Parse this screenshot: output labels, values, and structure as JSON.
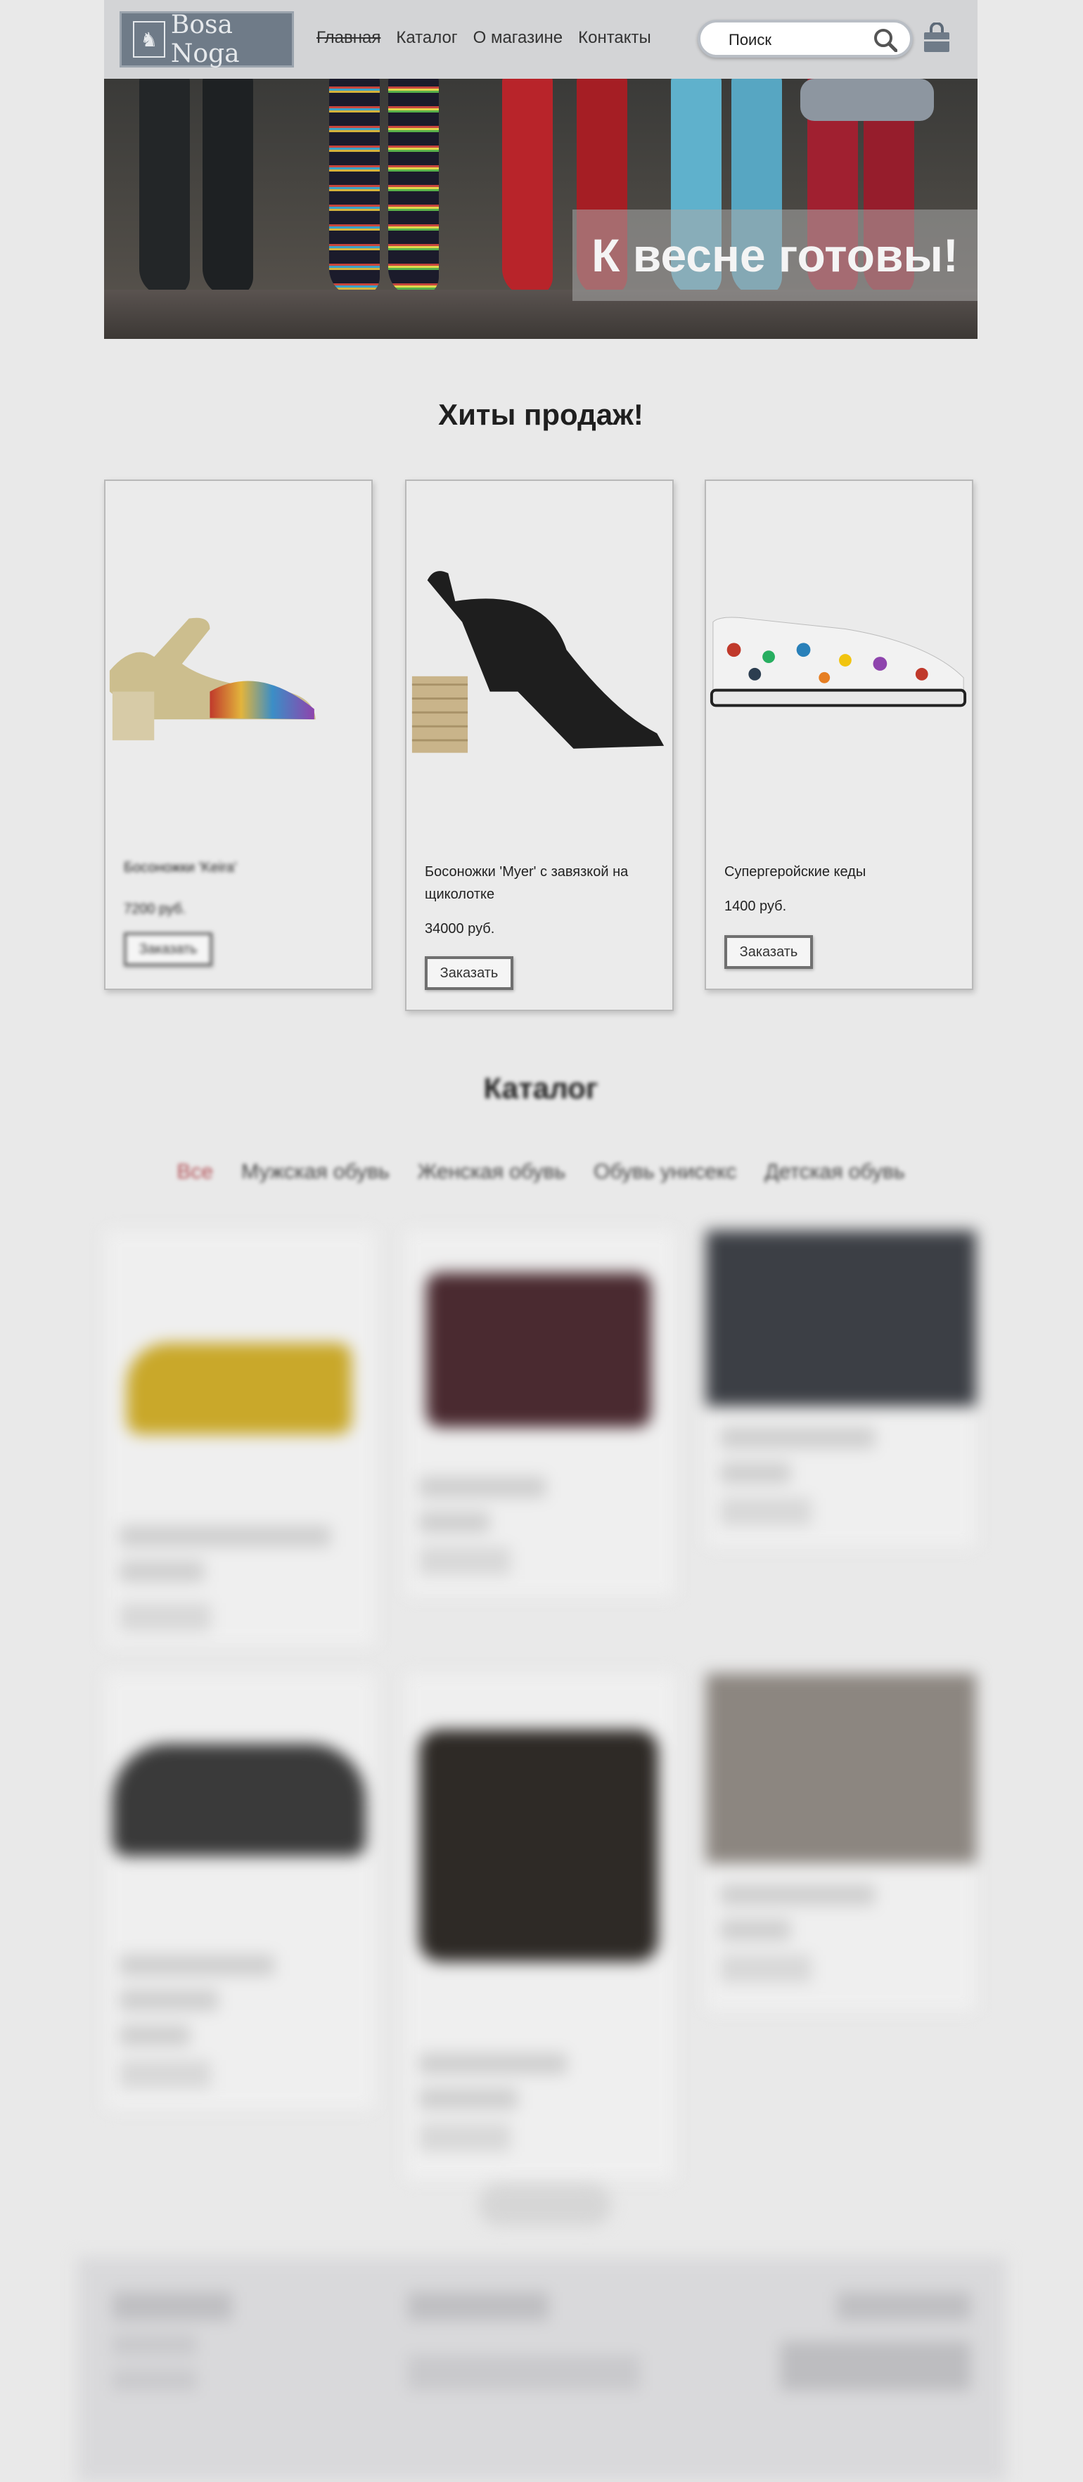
{
  "header": {
    "logo_text": "Bosa Noga",
    "nav": [
      "Главная",
      "Каталог",
      "О магазине",
      "Контакты"
    ],
    "search_placeholder": "Поиск"
  },
  "hero": {
    "caption": "К весне готовы!"
  },
  "bestsellers": {
    "title": "Хиты продаж!",
    "items": [
      {
        "name": "Босоножки 'Keira'",
        "price": "7200 руб.",
        "button": "Заказать"
      },
      {
        "name": "Босоножки 'Myer' с завязкой на щиколотке",
        "price": "34000 руб.",
        "button": "Заказать"
      },
      {
        "name": "Супергеройские кеды",
        "price": "1400 руб.",
        "button": "Заказать"
      }
    ]
  },
  "catalog": {
    "title": "Каталог",
    "tabs": [
      "Все",
      "Мужская обувь",
      "Женская обувь",
      "Обувь унисекс",
      "Детская обувь"
    ]
  },
  "colors": {
    "background": "#e9e9e9",
    "header": "#d3d4d6",
    "tab_active": "#b14d53"
  }
}
